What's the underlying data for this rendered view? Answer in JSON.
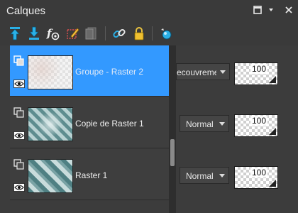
{
  "window": {
    "title": "Calques"
  },
  "layers": [
    {
      "name": "Groupe - Raster 2",
      "selected": true,
      "blend_mode": "ecouvreme",
      "opacity": "100"
    },
    {
      "name": "Copie de Raster 1",
      "selected": false,
      "blend_mode": "Normal",
      "opacity": "100"
    },
    {
      "name": "Raster 1",
      "selected": false,
      "blend_mode": "Normal",
      "opacity": "100"
    }
  ],
  "icons": {
    "toolbar": [
      "move-layer-up-icon",
      "move-layer-down-icon",
      "effects-icon",
      "edit-selection-icon",
      "mask-icon",
      "link-icon",
      "lock-icon",
      "view-icon"
    ],
    "window": [
      "restore-icon",
      "dropdown-menu-icon",
      "close-icon"
    ]
  },
  "colors": {
    "selection": "#3399ff",
    "panel": "#3c3c3c",
    "accent_blue": "#2ab0e6"
  }
}
